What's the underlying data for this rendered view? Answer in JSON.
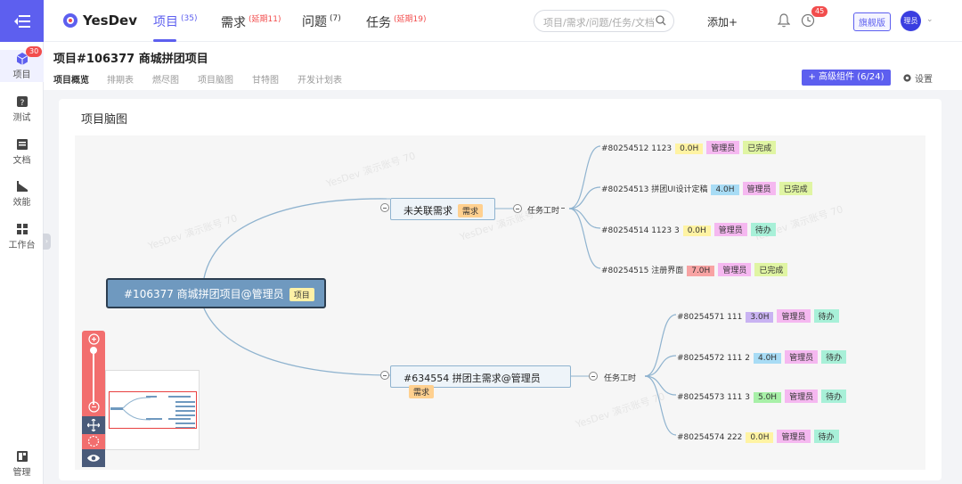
{
  "app": {
    "name": "YesDev"
  },
  "topnav": [
    {
      "label": "项目",
      "sup": "(35)",
      "sup_red": false
    },
    {
      "label": "需求",
      "sup": "(延期11)",
      "sup_red": true
    },
    {
      "label": "问题",
      "sup": "(7)",
      "sup_red": false
    },
    {
      "label": "任务",
      "sup": "(延期19)",
      "sup_red": true
    }
  ],
  "search": {
    "placeholder": "项目/需求/问题/任务/文档"
  },
  "add_label": "添加+",
  "notifications": {
    "clock_badge": "45"
  },
  "flagship_label": "旗舰版",
  "avatar_text": "理员",
  "rail": {
    "items": [
      {
        "label": "项目",
        "icon": "cube-icon",
        "badge": "30"
      },
      {
        "label": "测试",
        "icon": "test-icon"
      },
      {
        "label": "文档",
        "icon": "doc-icon"
      },
      {
        "label": "效能",
        "icon": "chart-icon"
      },
      {
        "label": "工作台",
        "icon": "workbench-icon"
      }
    ],
    "bottom": {
      "label": "管理",
      "icon": "manage-icon"
    }
  },
  "project": {
    "title": "项目#106377 商城拼团项目",
    "tabs": [
      "项目概览",
      "排期表",
      "燃尽图",
      "项目脑图",
      "甘特图",
      "开发计划表"
    ],
    "advanced_button": "+ 高级组件 (6/24)",
    "settings_label": "设置"
  },
  "mindmap": {
    "card_title": "项目脑图",
    "root": {
      "label": "#106377 商城拼团项目@管理员",
      "tag": "项目"
    },
    "branches": [
      {
        "label": "未关联需求",
        "tag": "需求",
        "group": "任务工时",
        "tasks": [
          {
            "name": "#80254512 1123",
            "hours": "0.0H",
            "hours_color": "#fff3a3",
            "owner": "管理员",
            "status": "已完成"
          },
          {
            "name": "#80254513 拼团UI设计定稿",
            "hours": "4.0H",
            "hours_color": "#a8dcf5",
            "owner": "管理员",
            "status": "已完成"
          },
          {
            "name": "#80254514 1123 3",
            "hours": "0.0H",
            "hours_color": "#fff3a3",
            "owner": "管理员",
            "status": "待办"
          },
          {
            "name": "#80254515 注册界面",
            "hours": "7.0H",
            "hours_color": "#f8a3a3",
            "owner": "管理员",
            "status": "已完成"
          }
        ]
      },
      {
        "label": "#634554 拼团主需求@管理员",
        "tag": "需求",
        "group": "任务工时",
        "tasks": [
          {
            "name": "#80254571 111",
            "hours": "3.0H",
            "hours_color": "#c9b3f2",
            "owner": "管理员",
            "status": "待办"
          },
          {
            "name": "#80254572 111 2",
            "hours": "4.0H",
            "hours_color": "#a8dcf5",
            "owner": "管理员",
            "status": "待办"
          },
          {
            "name": "#80254573 111 3",
            "hours": "5.0H",
            "hours_color": "#a8f0a8",
            "owner": "管理员",
            "status": "待办"
          },
          {
            "name": "#80254574 222",
            "hours": "0.0H",
            "hours_color": "#fff3a3",
            "owner": "管理员",
            "status": "待办"
          }
        ]
      }
    ]
  },
  "watermark": "YesDev 演示账号 70"
}
